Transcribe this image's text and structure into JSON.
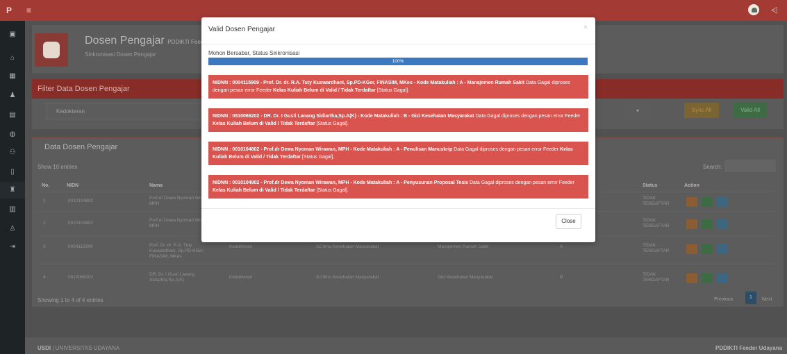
{
  "topbar": {
    "brand": "P"
  },
  "header": {
    "title": "Dosen Pengajar",
    "title_small": "PDDIKTI Feeder Udayana",
    "subtitle": "Sinkronisasi Dosen Pengajar"
  },
  "filter": {
    "title": "Filter Data Dosen Pengajar",
    "select_value": "Kedokteran",
    "sync_all": "Sync All",
    "valid_all": "Valid All"
  },
  "table": {
    "title": "Data Dosen Pengajar",
    "show": "Show",
    "show_value": "10",
    "entries": "entries",
    "search_label": "Search:",
    "headers": {
      "no": "No.",
      "nidn": "NIDN",
      "nama": "Nama",
      "status": "Status",
      "action": "Action"
    },
    "rows": [
      {
        "no": "1",
        "nidn": "0010104802",
        "nama1": "Prof.dr Dewa Nyoman Wirawan,",
        "nama2": "MPH",
        "nama3": "",
        "fak": "",
        "prodi": "",
        "mk": "",
        "kelas": "",
        "status1": "TIDAK",
        "status2": "TERDAFTAR"
      },
      {
        "no": "2",
        "nidn": "0010104802",
        "nama1": "Prof.dr Dewa Nyoman Wirawan,",
        "nama2": "MPH",
        "nama3": "",
        "fak": "",
        "prodi": "",
        "mk": "",
        "kelas": "",
        "status1": "TIDAK",
        "status2": "TERDAFTAR"
      },
      {
        "no": "3",
        "nidn": "0004115909",
        "nama1": "Prof. Dr. dr. R.A. Tuty",
        "nama2": "Kuswardhani, Sp.PD-KGer,",
        "nama3": "FINASIM, MKes",
        "fak": "Kedokteran",
        "prodi": "S2 Ilmu Kesehatan Masyarakat",
        "mk": "Manajemen Rumah Sakit",
        "kelas": "A",
        "status1": "TIDAK",
        "status2": "TERDAFTAR"
      },
      {
        "no": "4",
        "nidn": "0810066202",
        "nama1": "DR. Dr. I Gusti Lanang",
        "nama2": "Sidiartha,Sp.A(K)",
        "nama3": "",
        "fak": "Kedokteran",
        "prodi": "S2 Ilmu Kesehatan Masyarakat",
        "mk": "Gizi Kesehatan Masyarakat",
        "kelas": "B",
        "status1": "TIDAK",
        "status2": "TERDAFTAR"
      }
    ],
    "showing": "Showing 1 to 4 of 4 entries",
    "prev": "Previous",
    "page": "1",
    "next": "Next"
  },
  "footer": {
    "left_bold": "USDI",
    "left_rest": " | UNIVERSITAS UDAYANA",
    "right": "PDDIKTI Feeder Udayana"
  },
  "modal": {
    "title": "Valid Dosen Pengajar",
    "close_x": "×",
    "message": "Mohon Bersabar, Status Sinkronisasi",
    "progress_label": "100%",
    "progress_value": 100,
    "alerts": [
      {
        "bold1": "NIDNN : 0004115909 - Prof. Dr. dr. R.A. Tuty Kuswardhani, Sp.PD-KGer, FINASIM, MKes - Kode Matakuliah : A - Manajemen Rumah Sakit",
        "text1": " Data Gagal diproses dengan pesan error Feeder ",
        "bold2": "Kelas Kuliah Belum di Valid / Tidak Terdaftar",
        "text2": " [Status Gagal]."
      },
      {
        "bold1": "NIDNN : 0810066202 - DR. Dr. I Gusti Lanang Sidiartha,Sp.A(K) - Kode Matakuliah : B - Gizi Kesehatan Masyarakat",
        "text1": " Data Gagal diproses dengan pesan error Feeder ",
        "bold2": "Kelas Kuliah Belum di Valid / Tidak Terdaftar",
        "text2": " [Status Gagal]."
      },
      {
        "bold1": "NIDNN : 0010104802 - Prof.dr Dewa Nyoman Wirawan, MPH - Kode Matakuliah : A - Penulisan Manuskrip",
        "text1": " Data Gagal diproses dengan pesan error Feeder ",
        "bold2": "Kelas Kuliah Belum di Valid / Tidak Terdaftar",
        "text2": " [Status Gagal]."
      },
      {
        "bold1": "NIDNN : 0010104802 - Prof.dr Dewa Nyoman Wirawan, MPH - Kode Matakuliah : A - Penyusunan Proposal Tesis",
        "text1": " Data Gagal diproses dengan pesan error Feeder ",
        "bold2": "Kelas Kuliah Belum di Valid / Tidak Terdaftar",
        "text2": " [Status Gagal]."
      }
    ],
    "close_label": "Close"
  },
  "colors": {
    "topbar": "#a33a33",
    "alert": "#d9534f",
    "progress": "#3b78c0",
    "sidebar": "#1e2326"
  },
  "icons": {
    "menu": "hamburger-icon",
    "user": "user-avatar-icon",
    "settings": "share-icon"
  }
}
